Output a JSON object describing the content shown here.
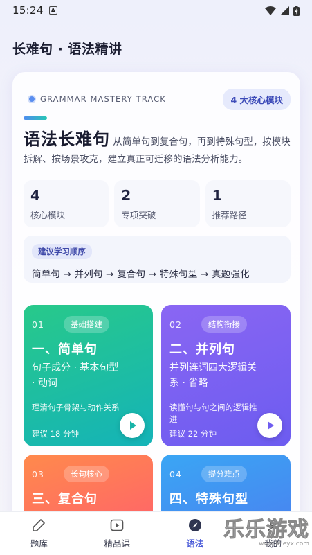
{
  "status": {
    "time": "15:24",
    "notif_glyph": "A"
  },
  "header": {
    "title": "长难句 · 语法精讲"
  },
  "track": {
    "label": "GRAMMAR MASTERY TRACK",
    "badge": "4 大核心模块"
  },
  "intro": {
    "title": "语法长难句",
    "text": "从简单句到复合句，再到特殊句型，按模块拆解、按场景攻克，建立真正可迁移的语法分析能力。"
  },
  "stats": [
    {
      "num": "4",
      "label": "核心模块"
    },
    {
      "num": "2",
      "label": "专项突破"
    },
    {
      "num": "1",
      "label": "推荐路径"
    }
  ],
  "route": {
    "tag": "建议学习顺序",
    "text": "简单句 → 并列句 → 复合句 → 特殊句型 → 真题强化"
  },
  "modules": [
    {
      "no": "01",
      "tag": "基础搭建",
      "title": "一、简单句",
      "desc": "句子成分 · 基本句型 · 动词",
      "note": "理清句子骨架与动作关系",
      "time": "建议 18 分钟"
    },
    {
      "no": "02",
      "tag": "结构衔接",
      "title": "二、并列句",
      "desc": "并列连词四大逻辑关系 · 省略",
      "note": "读懂句与句之间的逻辑推进",
      "time": "建议 22 分钟"
    },
    {
      "no": "03",
      "tag": "长句核心",
      "title": "三、复合句"
    },
    {
      "no": "04",
      "tag": "提分难点",
      "title": "四、特殊句型"
    }
  ],
  "nav": [
    {
      "label": "题库",
      "icon": "edit-icon"
    },
    {
      "label": "精品课",
      "icon": "video-icon"
    },
    {
      "label": "语法",
      "icon": "compass-icon",
      "active": true
    },
    {
      "label": "我的",
      "icon": "user-icon"
    }
  ],
  "watermark": {
    "text": "乐乐游戏",
    "sub": "www.leleyx.com"
  },
  "colors": {
    "accent": "#4a5bd8",
    "green": "#28c98a",
    "purple": "#8a66f3",
    "orange": "#ff8a4c",
    "blue": "#3aa6f4"
  }
}
